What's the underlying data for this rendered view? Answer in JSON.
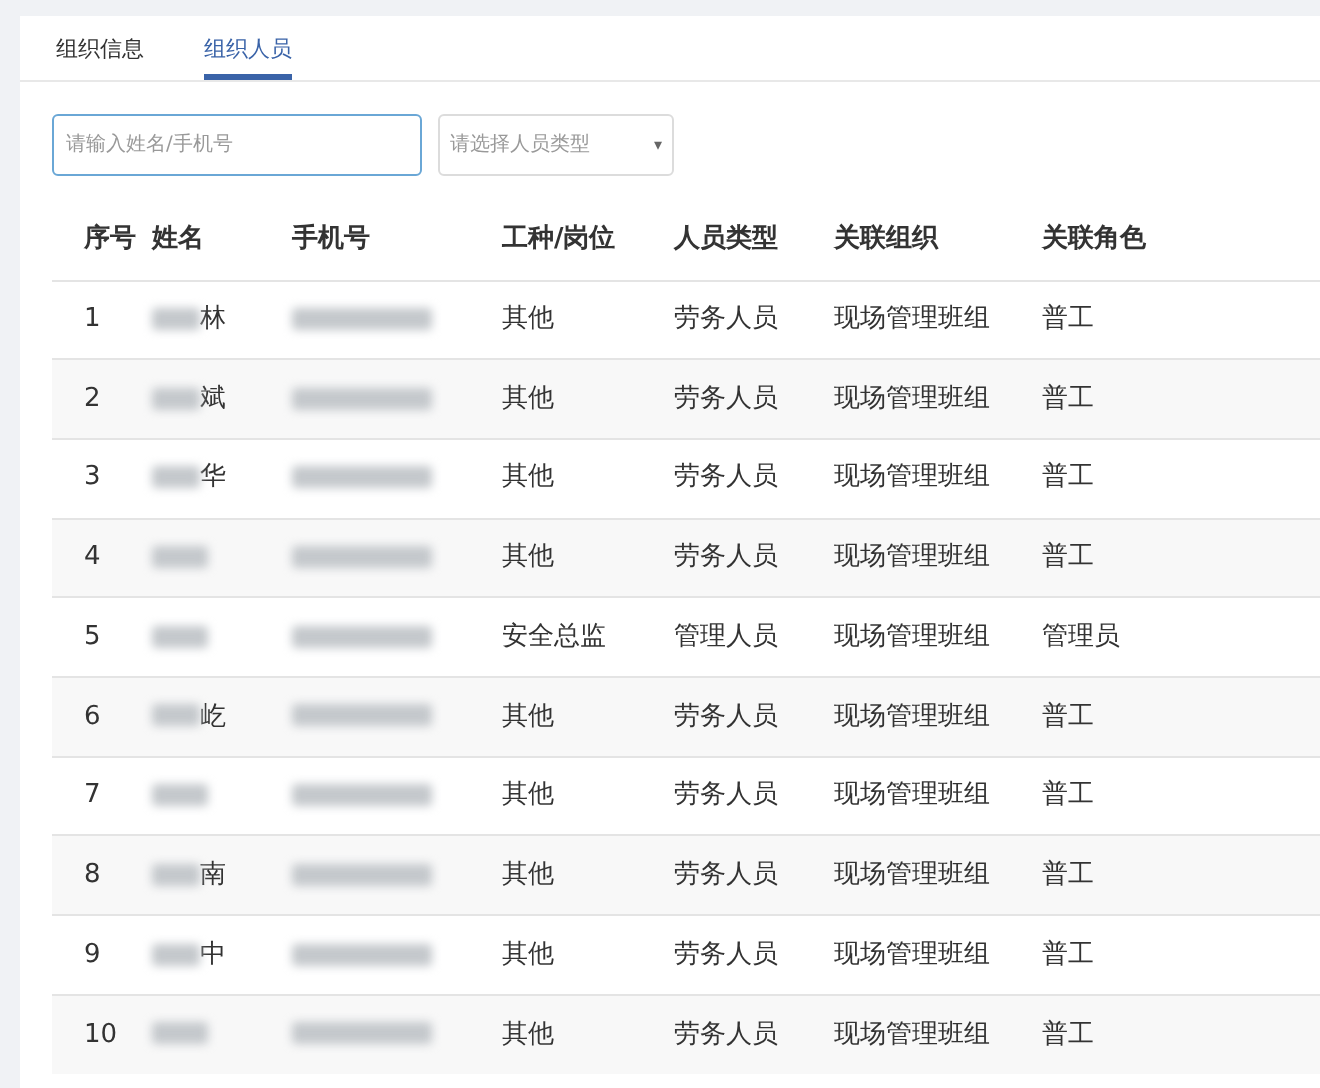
{
  "tabs": [
    {
      "label": "组织信息",
      "selected": false
    },
    {
      "label": "组织人员",
      "selected": true
    }
  ],
  "search": {
    "placeholder": "请输入姓名/手机号"
  },
  "type_select": {
    "placeholder": "请选择人员类型",
    "caret": "▾"
  },
  "table": {
    "columns": [
      "序号",
      "姓名",
      "手机号",
      "工种/岗位",
      "人员类型",
      "关联组织",
      "关联角色"
    ],
    "rows": [
      {
        "index": "1",
        "name": "林",
        "name_blurred": true,
        "phone_blurred": true,
        "post": "其他",
        "type": "劳务人员",
        "org": "现场管理班组",
        "role": "普工"
      },
      {
        "index": "2",
        "name": "斌",
        "name_blurred": true,
        "phone_blurred": true,
        "post": "其他",
        "type": "劳务人员",
        "org": "现场管理班组",
        "role": "普工"
      },
      {
        "index": "3",
        "name": "华",
        "name_blurred": true,
        "phone_blurred": true,
        "post": "其他",
        "type": "劳务人员",
        "org": "现场管理班组",
        "role": "普工"
      },
      {
        "index": "4",
        "name_blurred": true,
        "phone_blurred": true,
        "post": "其他",
        "type": "劳务人员",
        "org": "现场管理班组",
        "role": "普工"
      },
      {
        "index": "5",
        "name_blurred": true,
        "phone_blurred": true,
        "post": "安全总监",
        "type": "管理人员",
        "org": "现场管理班组",
        "role": "管理员"
      },
      {
        "index": "6",
        "name": "屹",
        "name_blurred": true,
        "phone_blurred": true,
        "post": "其他",
        "type": "劳务人员",
        "org": "现场管理班组",
        "role": "普工"
      },
      {
        "index": "7",
        "name_blurred": true,
        "phone_blurred": true,
        "post": "其他",
        "type": "劳务人员",
        "org": "现场管理班组",
        "role": "普工"
      },
      {
        "index": "8",
        "name": "南",
        "name_blurred": true,
        "phone_blurred": true,
        "post": "其他",
        "type": "劳务人员",
        "org": "现场管理班组",
        "role": "普工"
      },
      {
        "index": "9",
        "name": "中",
        "name_blurred": true,
        "phone_blurred": true,
        "post": "其他",
        "type": "劳务人员",
        "org": "现场管理班组",
        "role": "普工"
      },
      {
        "index": "10",
        "name_blurred": true,
        "phone_blurred": true,
        "post": "其他",
        "type": "劳务人员",
        "org": "现场管理班组",
        "role": "普工"
      }
    ]
  }
}
